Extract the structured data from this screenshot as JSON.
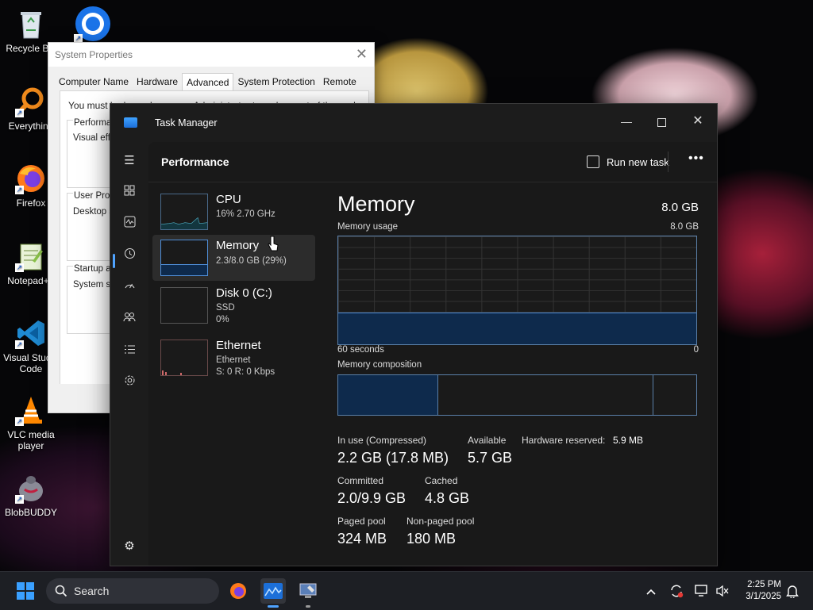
{
  "desktop": {
    "icons": [
      {
        "label": "Recycle Bin",
        "icon": "recycle-bin-icon"
      },
      {
        "label": "Everything",
        "icon": "everything-icon"
      },
      {
        "label": "Firefox",
        "icon": "firefox-icon"
      },
      {
        "label": "Notepad++",
        "icon": "notepad-plus-plus-icon"
      },
      {
        "label": "Visual Studio Code",
        "icon": "vscode-icon"
      },
      {
        "label": "VLC media player",
        "icon": "vlc-icon"
      },
      {
        "label": "BlobBUDDY",
        "icon": "blobbuddy-icon"
      }
    ],
    "chrome_icon": "chrome-icon"
  },
  "system_properties": {
    "title": "System Properties",
    "tabs": [
      "Computer Name",
      "Hardware",
      "Advanced",
      "System Protection",
      "Remote"
    ],
    "active_tab": "Advanced",
    "notice": "You must be logged on as an Administrator to make most of these changes.",
    "groups": [
      {
        "title": "Performance",
        "desc": "Visual effects"
      },
      {
        "title": "User Profiles",
        "desc": "Desktop settings"
      },
      {
        "title": "Startup and Recovery",
        "desc": "System startup"
      }
    ]
  },
  "task_manager": {
    "title": "Task Manager",
    "page_title": "Performance",
    "run_new_task": "Run new task",
    "more": "•••",
    "nav": [
      "hamburger-menu-icon",
      "processes-icon",
      "performance-icon",
      "app-history-icon",
      "startup-apps-icon",
      "users-icon",
      "details-icon",
      "services-icon",
      "settings-icon"
    ],
    "devices": [
      {
        "name": "CPU",
        "line1": "16% 2.70 GHz",
        "line2": ""
      },
      {
        "name": "Memory",
        "line1": "2.3/8.0 GB (29%)",
        "line2": ""
      },
      {
        "name": "Disk 0 (C:)",
        "line1": "SSD",
        "line2": "0%"
      },
      {
        "name": "Ethernet",
        "line1": "Ethernet",
        "line2": "S: 0 R: 0 Kbps"
      }
    ],
    "memory": {
      "heading": "Memory",
      "capacity": "8.0 GB",
      "usage_label": "Memory usage",
      "usage_max": "8.0 GB",
      "time_left": "60 seconds",
      "time_right": "0",
      "usage_fraction": 0.29,
      "composition_label": "Memory composition",
      "composition_fractions": [
        0.28,
        0.6,
        0.12
      ],
      "stats": {
        "in_use_label": "In use (Compressed)",
        "in_use": "2.2 GB (17.8 MB)",
        "available_label": "Available",
        "available": "5.7 GB",
        "hw_reserved_label": "Hardware reserved:",
        "hw_reserved": "5.9 MB",
        "committed_label": "Committed",
        "committed": "2.0/9.9 GB",
        "cached_label": "Cached",
        "cached": "4.8 GB",
        "paged_label": "Paged pool",
        "paged": "324 MB",
        "nonpaged_label": "Non-paged pool",
        "nonpaged": "180 MB"
      }
    }
  },
  "taskbar": {
    "search_placeholder": "Search",
    "time": "2:25 PM",
    "date": "3/1/2025",
    "accent": "#4fa3ff"
  }
}
